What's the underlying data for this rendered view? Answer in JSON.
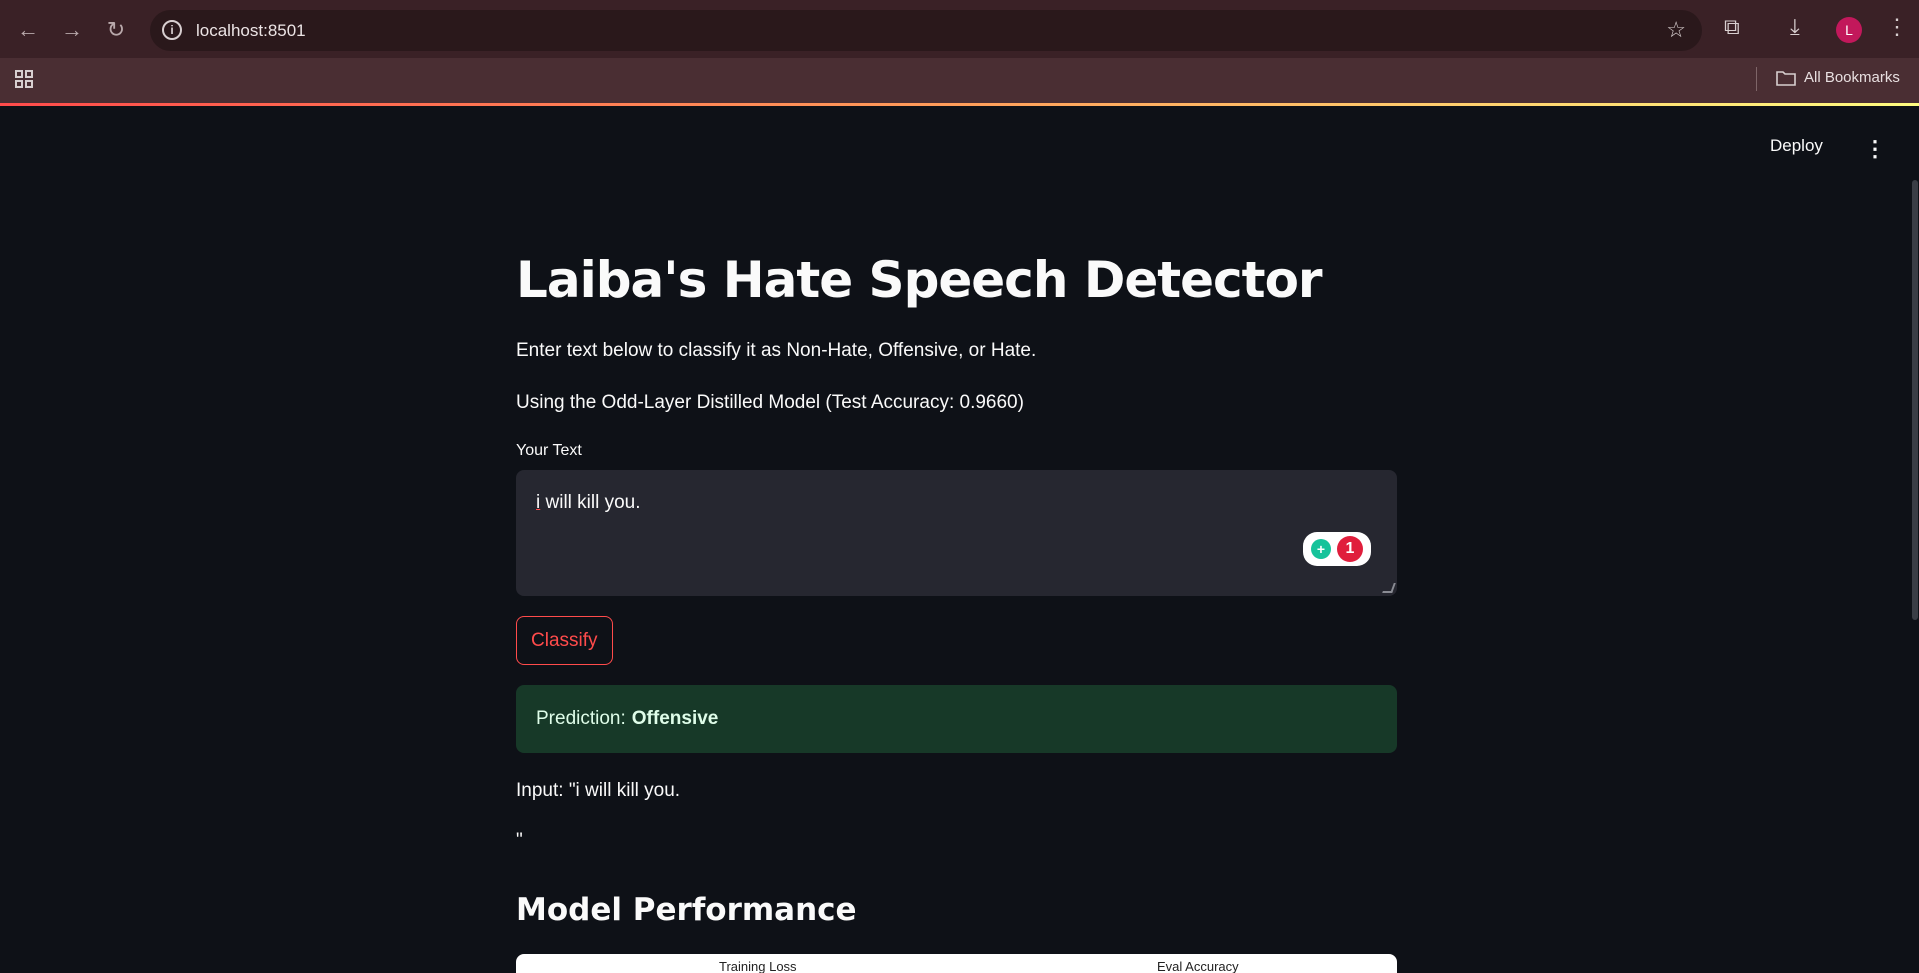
{
  "browser": {
    "url": "localhost:8501",
    "avatar_letter": "L",
    "bookmarks_label": "All Bookmarks"
  },
  "header": {
    "deploy_label": "Deploy"
  },
  "main": {
    "title": "Laiba's Hate Speech Detector",
    "intro": "Enter text below to classify it as Non-Hate, Offensive, or Hate.",
    "model_info": "Using the Odd-Layer Distilled Model (Test Accuracy: 0.9660)",
    "text_label": "Your Text",
    "text_value_first": "i",
    "text_value_rest": " will kill you.",
    "grammar_count": "1",
    "classify_label": "Classify",
    "prediction_label": "Prediction:",
    "prediction_value": "Offensive",
    "input_echo": "Input: \"i will kill you.",
    "input_echo_close": "\"",
    "section_title": "Model Performance",
    "chart_titles": [
      "Training Loss",
      "Eval Accuracy"
    ]
  },
  "colors": {
    "accent": "#ff4b4b",
    "success_bg": "#173928",
    "page_bg": "#0e1117"
  }
}
